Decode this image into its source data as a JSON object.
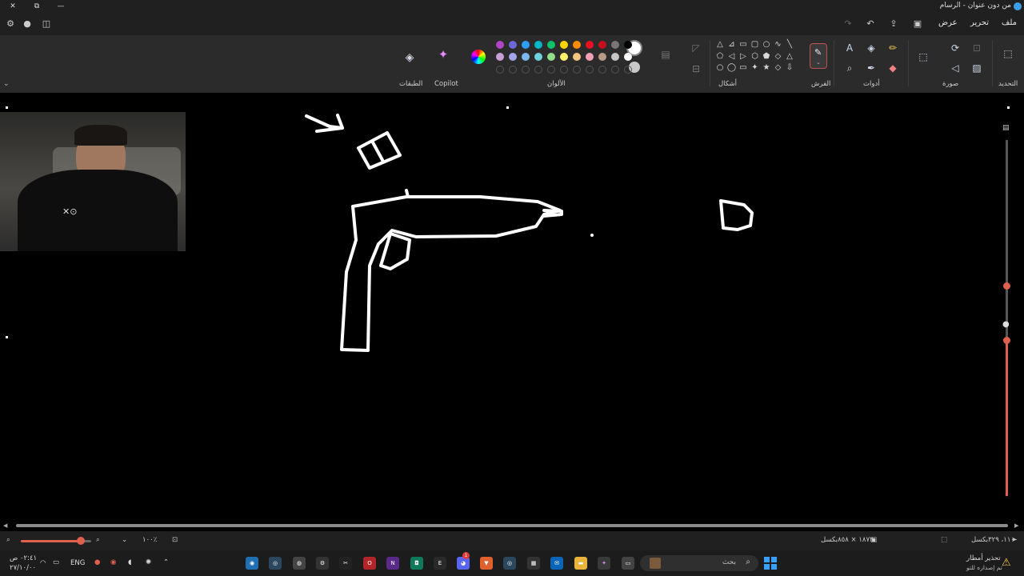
{
  "window": {
    "title": "من دون عنوان - الرسام",
    "controls": {
      "close": "✕",
      "restore": "⧉",
      "minimize": "—"
    }
  },
  "menu": {
    "file": "ملف",
    "edit": "تحرير",
    "view": "عرض"
  },
  "ribbon": {
    "groups": {
      "select": "التحديد",
      "image": "صورة",
      "tools": "أدوات",
      "brushes": "الفرش",
      "shapes": "أشكال",
      "colors": "الألوان",
      "copilot": "Copilot",
      "layers": "الطبقات"
    },
    "palette_row1": [
      "#b146c2",
      "#6b69d6",
      "#2d9ff5",
      "#00b7c3",
      "#10c06a",
      "#ffd400",
      "#ff8c00",
      "#e81123",
      "#c50f1f",
      "#7a7574",
      "#000000"
    ],
    "palette_row2": [
      "#c7a1d6",
      "#a5a4e8",
      "#7ab8ef",
      "#6fd3dc",
      "#93dd8a",
      "#fff16b",
      "#f4c483",
      "#f29fb3",
      "#b99a86",
      "#c8c6c4",
      "#ffffff"
    ],
    "primary_color": "#ffffff",
    "secondary_color": "#c8c8c8"
  },
  "status": {
    "cursor_position": "١١٠٠، ٣٢٩بكسل",
    "canvas_size": "١٨٧٢ × ٨٥٨بكسل",
    "zoom": "١٠٠٪",
    "zoom_level": 0.85
  },
  "taskbar": {
    "search_placeholder": "بحث",
    "language": "ENG",
    "time": "٠٢:٤١ ص",
    "date": "٢٧/١٠/٠٠",
    "notification_title": "تحذير أمطار",
    "notification_body": "تم إصداره للتو",
    "discord_badge": "1"
  }
}
